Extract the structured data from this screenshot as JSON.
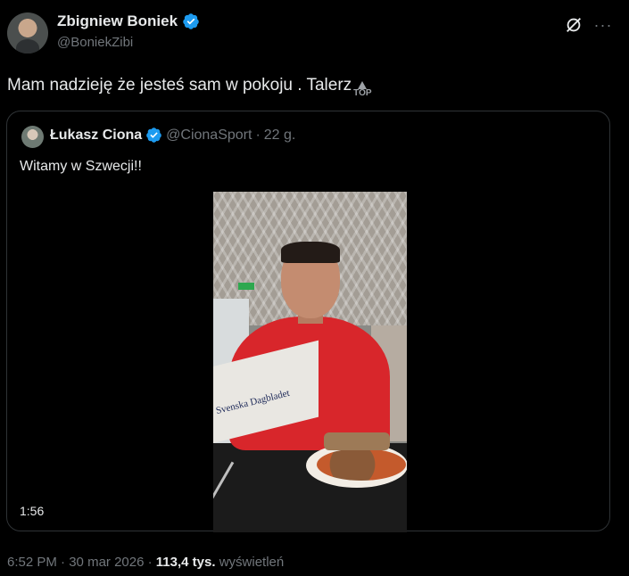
{
  "author": {
    "name": "Zbigniew Boniek",
    "handle": "@BoniekZibi"
  },
  "tweet": {
    "text": "Mam nadzieję że jesteś sam w pokoju . Talerz",
    "emoji_label": "TOP"
  },
  "quoted": {
    "name": "Łukasz Ciona",
    "handle": "@CionaSport",
    "separator": "·",
    "time": "22 g.",
    "text": "Witamy w Szwecji!!",
    "video_newspaper_title": "Svenska Dagbladet",
    "video_duration": "1:56"
  },
  "footer": {
    "time": "6:52 PM",
    "sep1": "·",
    "date": "30 mar 2026",
    "sep2": "·",
    "views_count": "113,4 tys.",
    "views_label": "wyświetleń"
  },
  "colors": {
    "background": "#000000",
    "text": "#e7e9ea",
    "secondary": "#71767b",
    "verified": "#1d9bf0",
    "border": "#2f3336"
  },
  "icons": [
    "verified-badge-icon",
    "grok-icon",
    "more-options-icon",
    "top-arrow-icon"
  ]
}
